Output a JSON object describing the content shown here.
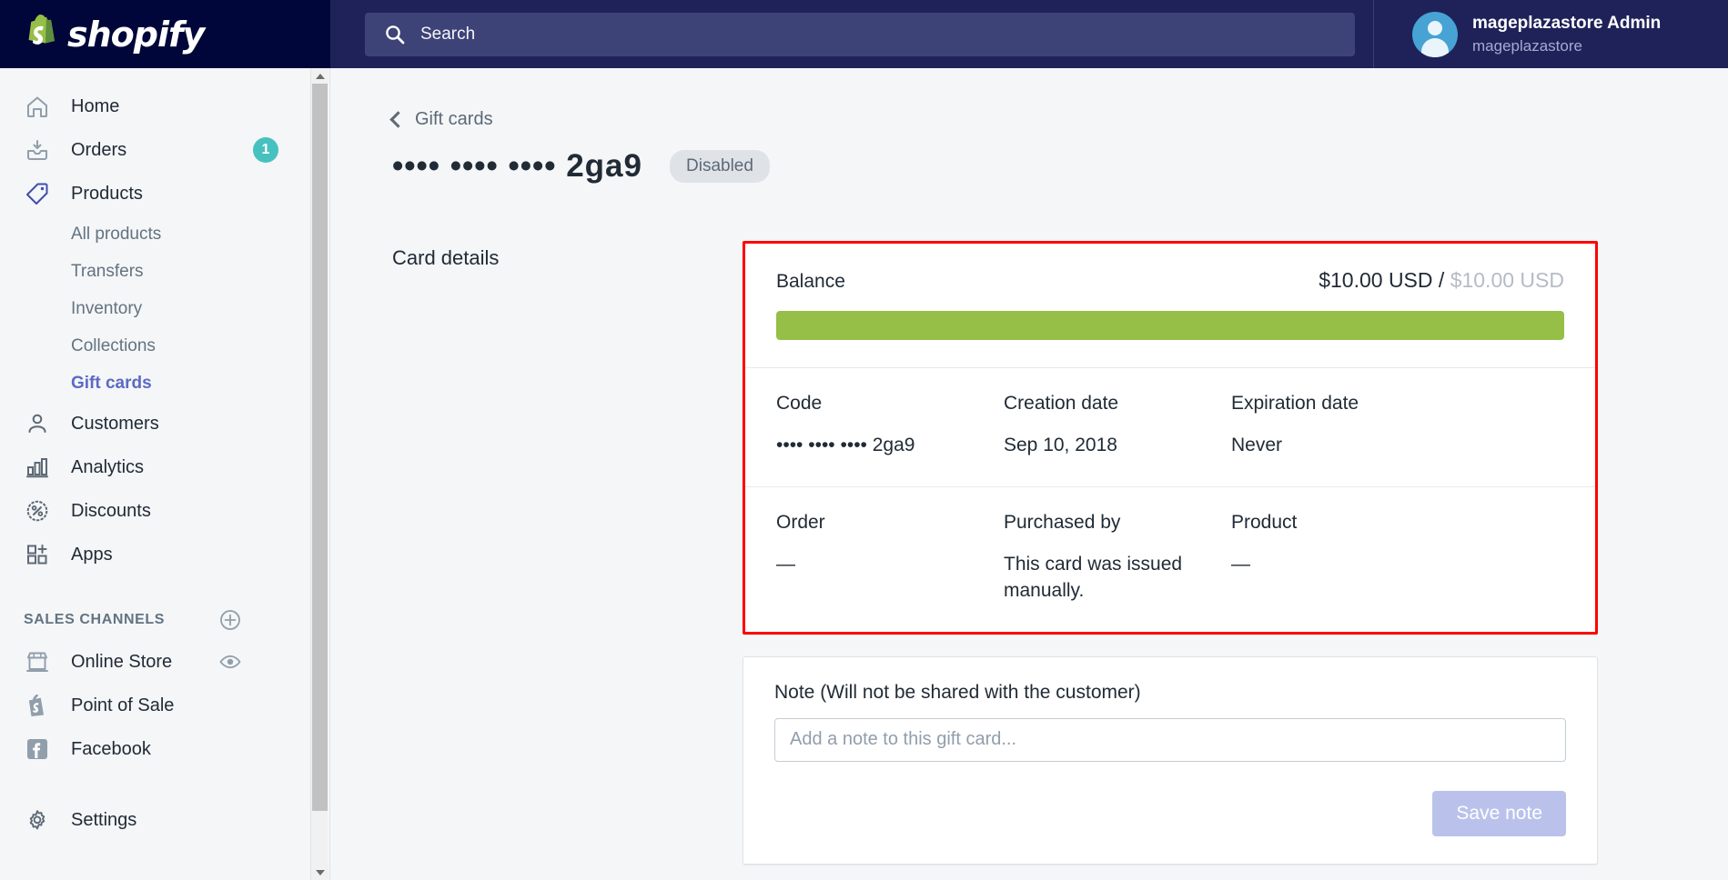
{
  "topbar": {
    "brand": "shopify",
    "search": {
      "placeholder": "Search",
      "icon": "search-icon"
    },
    "user": {
      "name": "mageplazastore Admin",
      "store": "mageplazastore"
    }
  },
  "sidebar": {
    "items": [
      {
        "label": "Home",
        "icon": "home-icon",
        "badge": null
      },
      {
        "label": "Orders",
        "icon": "orders-icon",
        "badge": "1"
      },
      {
        "label": "Products",
        "icon": "products-tag-icon",
        "badge": null
      },
      {
        "label": "Customers",
        "icon": "customers-icon",
        "badge": null
      },
      {
        "label": "Analytics",
        "icon": "analytics-bar-icon",
        "badge": null
      },
      {
        "label": "Discounts",
        "icon": "discounts-percent-icon",
        "badge": null
      },
      {
        "label": "Apps",
        "icon": "apps-grid-icon",
        "badge": null
      },
      {
        "label": "Settings",
        "icon": "gear-icon",
        "badge": null
      }
    ],
    "product_subitems": [
      {
        "label": "All products",
        "active": false
      },
      {
        "label": "Transfers",
        "active": false
      },
      {
        "label": "Inventory",
        "active": false
      },
      {
        "label": "Collections",
        "active": false
      },
      {
        "label": "Gift cards",
        "active": true
      }
    ],
    "sales_channels": {
      "title": "SALES CHANNELS",
      "add_icon": "plus-circle-icon",
      "items": [
        {
          "label": "Online Store",
          "icon": "storefront-icon",
          "trailing_icon": "eye-icon"
        },
        {
          "label": "Point of Sale",
          "icon": "pos-shopify-bag-icon",
          "trailing_icon": null
        },
        {
          "label": "Facebook",
          "icon": "facebook-icon",
          "trailing_icon": null
        }
      ]
    }
  },
  "main": {
    "back_link": "Gift cards",
    "title": "•••• •••• •••• 2ga9",
    "status": "Disabled",
    "section_label": "Card details",
    "balance": {
      "label": "Balance",
      "current": "$10.00 USD",
      "separator": "/",
      "total": "$10.00 USD",
      "percent": 100,
      "bar_color": "#95bf47"
    },
    "details": [
      {
        "label": "Code",
        "value": "•••• •••• •••• 2ga9"
      },
      {
        "label": "Creation date",
        "value": "Sep 10, 2018"
      },
      {
        "label": "Expiration date",
        "value": "Never"
      }
    ],
    "details2": [
      {
        "label": "Order",
        "value": "—"
      },
      {
        "label": "Purchased by",
        "value": "This card was issued manually."
      },
      {
        "label": "Product",
        "value": "—"
      }
    ],
    "note": {
      "label": "Note (Will not be shared with the customer)",
      "placeholder": "Add a note to this gift card...",
      "value": "",
      "save_label": "Save note"
    },
    "highlight_color": "#ff0000"
  }
}
